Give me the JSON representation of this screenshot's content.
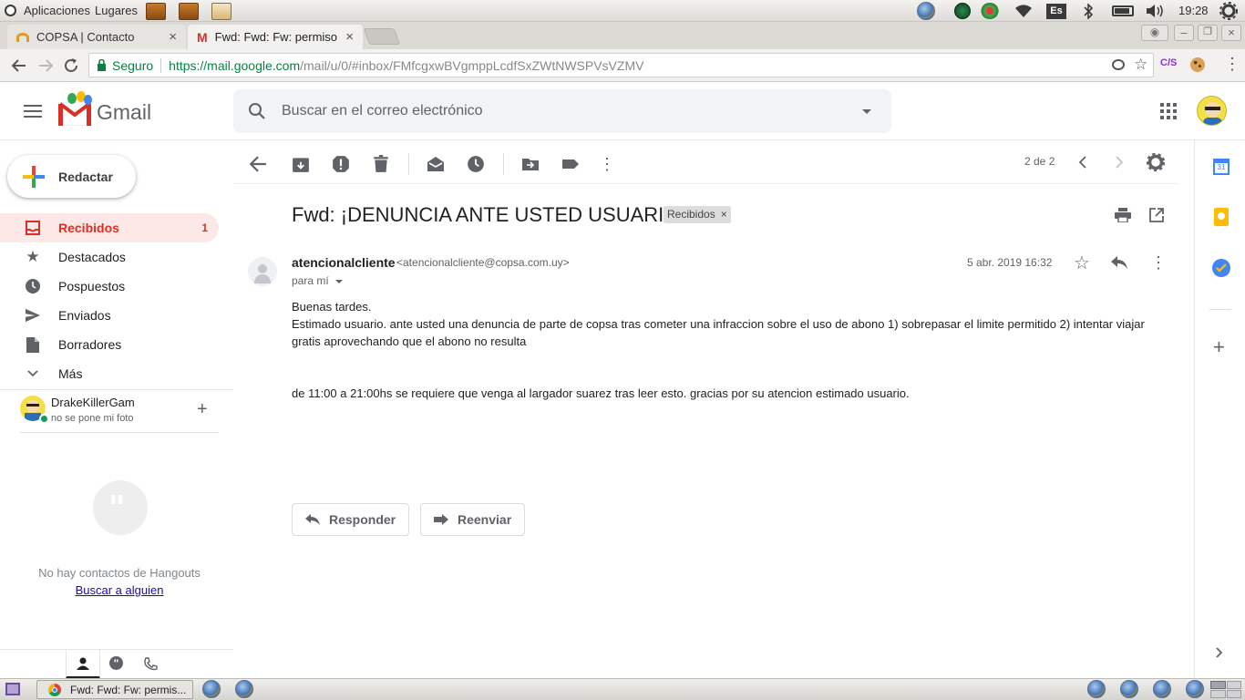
{
  "system": {
    "applications": "Aplicaciones",
    "places": "Lugares",
    "keyboard_layout": "Es",
    "clock": "19:28"
  },
  "browser": {
    "tabs": [
      {
        "title": "COPSA | Contacto",
        "active": false
      },
      {
        "title": "Fwd: Fwd: Fw: permiso p",
        "active": true
      }
    ],
    "secure_label": "Seguro",
    "url_host": "https://mail.google.com",
    "url_path": "/mail/u/0/#inbox/FMfcgxwBVgmppLcdfSxZWtNWSPVsVZMV",
    "ext_label": "C/S"
  },
  "gmail": {
    "logo_text": "Gmail",
    "search_placeholder": "Buscar en el correo electrónico",
    "compose_label": "Redactar",
    "nav": [
      {
        "label": "Recibidos",
        "count": "1",
        "icon": "inbox-icon",
        "active": true
      },
      {
        "label": "Destacados",
        "count": "",
        "icon": "star-icon",
        "active": false
      },
      {
        "label": "Pospuestos",
        "count": "",
        "icon": "clock-icon",
        "active": false
      },
      {
        "label": "Enviados",
        "count": "",
        "icon": "send-icon",
        "active": false
      },
      {
        "label": "Borradores",
        "count": "",
        "icon": "draft-icon",
        "active": false
      },
      {
        "label": "Más",
        "count": "",
        "icon": "chevron-down-icon",
        "active": false
      }
    ],
    "hangouts": {
      "user_name": "DrakeKillerGam",
      "user_status": "no se pone mi foto",
      "empty_text": "No hay contactos de Hangouts",
      "find_link": "Buscar a alguien"
    },
    "pagination": "2 de 2",
    "email": {
      "subject": "Fwd: ¡DENUNCIA ANTE USTED USUARIO!",
      "label_chip": "Recibidos",
      "sender_name": "atencionalcliente",
      "sender_email": "<atencionalcliente@copsa.com.uy>",
      "to_line": "para mí",
      "date": "5 abr. 2019 16:32",
      "body_line1": "Buenas tardes.",
      "body_line2": "Estimado usuario. ante usted una denuncia de parte de copsa tras cometer una infraccion sobre el uso de abono 1) sobrepasar el limite permitido 2) intentar viajar",
      "body_line3": "gratis aprovechando que el abono no resulta",
      "body_line4": "de 11:00 a 21:00hs se requiere que venga al largador suarez tras leer esto. gracias por su atencion estimado usuario."
    },
    "reply_label": "Responder",
    "forward_label": "Reenviar"
  },
  "taskbar": {
    "window_title": "Fwd: Fwd: Fw: permis..."
  },
  "colors": {
    "gmail_red": "#d93025",
    "active_nav_bg": "#fce8e6",
    "link_blue": "#1a0dab",
    "secure_green": "#0b8043"
  }
}
